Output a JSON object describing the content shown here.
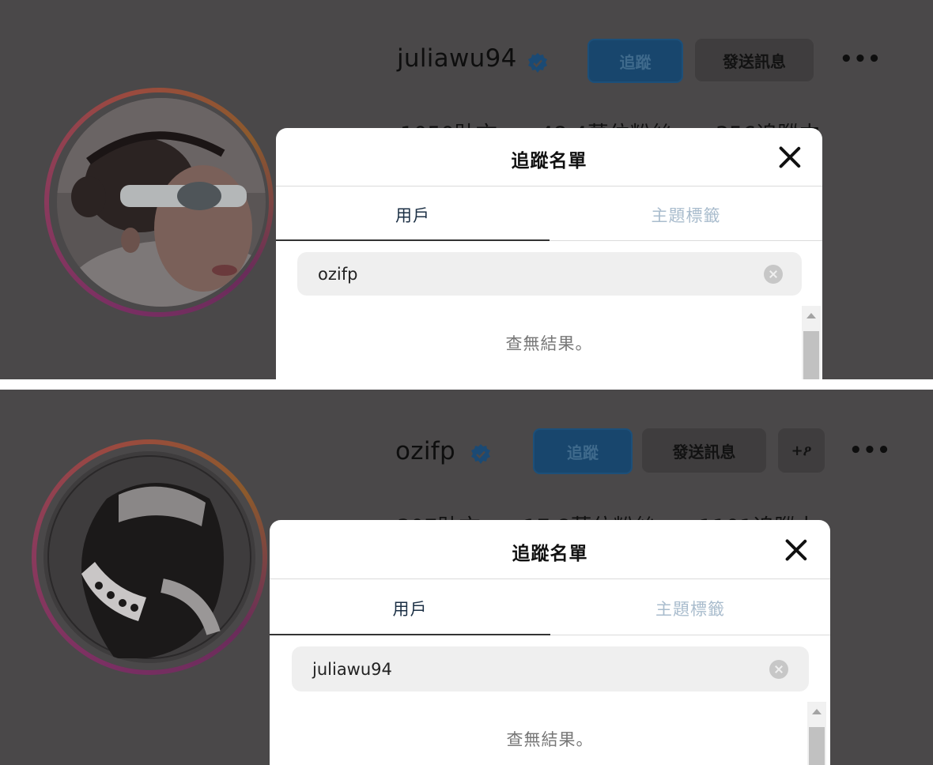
{
  "screens": [
    {
      "profile": {
        "username": "juliawu94",
        "follow_label": "追蹤",
        "message_label": "發送訊息",
        "more_label": "•••",
        "stats_text": "1050貼文　　48.4萬位粉絲　　356追蹤中"
      },
      "modal": {
        "title": "追蹤名單",
        "tabs": [
          "用戶",
          "主題標籤"
        ],
        "search_value": "ozifp",
        "empty_text": "查無結果。"
      }
    },
    {
      "profile": {
        "username": "ozifp",
        "follow_label": "追蹤",
        "message_label": "發送訊息",
        "add_user_label": "+ዖ",
        "more_label": "•••",
        "stats_text": "307貼文　　17.8萬位粉絲　　1101追蹤中"
      },
      "modal": {
        "title": "追蹤名單",
        "tabs": [
          "用戶",
          "主題標籤"
        ],
        "search_value": "juliawu94",
        "empty_text": "查無結果。"
      }
    }
  ],
  "colors": {
    "overlay_bg": "#4a4849",
    "follow_button": "#18466d",
    "active_tab": "#1b2f44",
    "inactive_tab": "#a9bccd"
  },
  "icons": [
    "verified-badge-icon",
    "close-icon",
    "clear-search-icon",
    "add-user-icon",
    "more-options-icon"
  ]
}
